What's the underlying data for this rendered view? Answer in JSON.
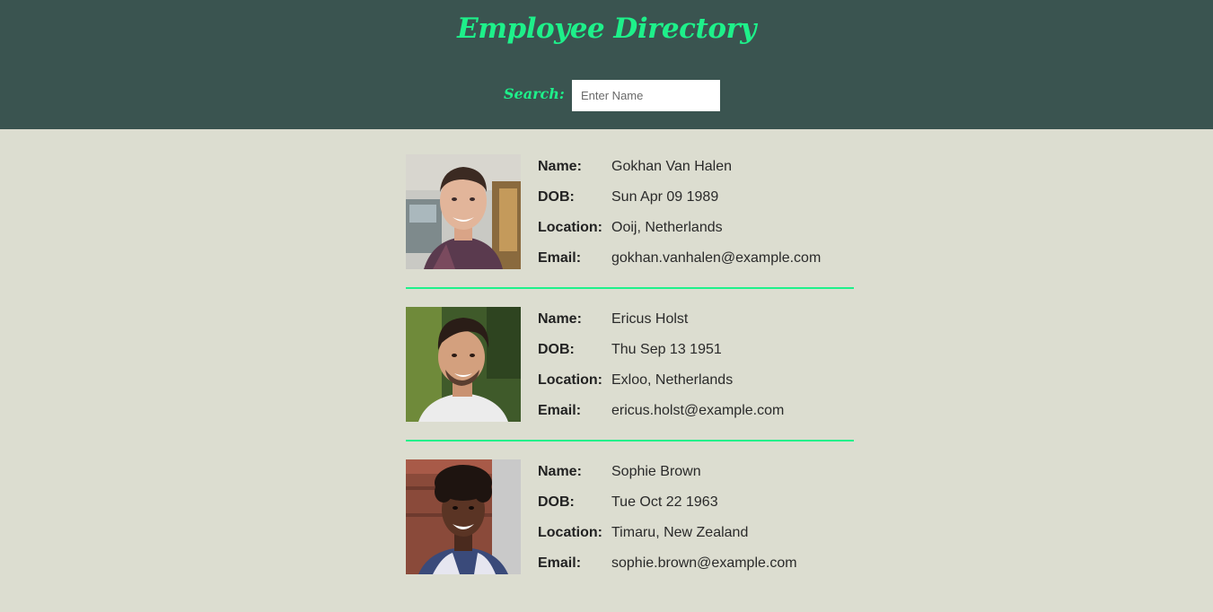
{
  "header": {
    "title": "Employee Directory",
    "search_label": "Search:",
    "search_placeholder": "Enter Name",
    "search_value": ""
  },
  "labels": {
    "name": "Name:",
    "dob": "DOB:",
    "location": "Location:",
    "email": "Email:"
  },
  "employees": [
    {
      "name": "Gokhan Van Halen",
      "dob": "Sun Apr 09 1989",
      "location": "Ooij, Netherlands",
      "email": "gokhan.vanhalen@example.com"
    },
    {
      "name": "Ericus Holst",
      "dob": "Thu Sep 13 1951",
      "location": "Exloo, Netherlands",
      "email": "ericus.holst@example.com"
    },
    {
      "name": "Sophie Brown",
      "dob": "Tue Oct 22 1963",
      "location": "Timaru, New Zealand",
      "email": "sophie.brown@example.com"
    }
  ],
  "colors": {
    "header_bg": "#3a5450",
    "accent": "#1ef08a",
    "page_bg": "#dcddd0"
  }
}
